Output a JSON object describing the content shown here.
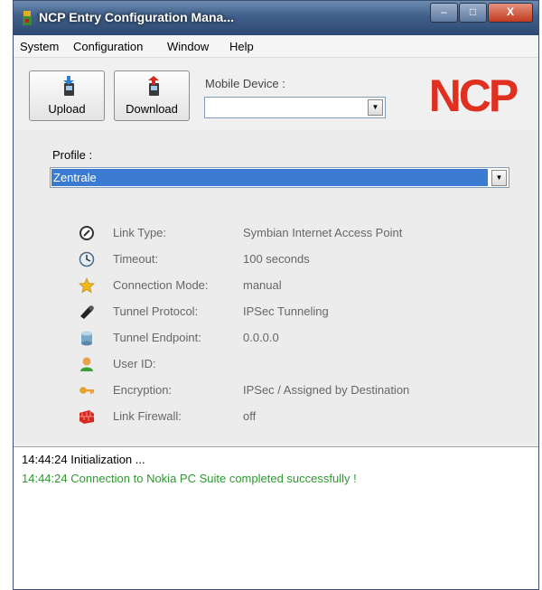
{
  "window": {
    "title": "NCP Entry Configuration Mana...",
    "buttons": {
      "minimize": "‒",
      "maximize": "□",
      "close": "X"
    }
  },
  "menu": [
    "System",
    "Configuration",
    "Window",
    "Help"
  ],
  "toolbar": {
    "upload_label": "Upload",
    "download_label": "Download",
    "mobile_device_label": "Mobile Device :",
    "mobile_device_value": ""
  },
  "logo": {
    "text": "NCP",
    "color": "#e03020"
  },
  "profile": {
    "label": "Profile :",
    "value": "Zentrale"
  },
  "info": [
    {
      "icon": "link-type-icon",
      "label": "Link Type:",
      "value": "Symbian Internet Access Point"
    },
    {
      "icon": "timeout-clock-icon",
      "label": "Timeout:",
      "value": "100 seconds"
    },
    {
      "icon": "star-icon",
      "label": "Connection Mode:",
      "value": "manual"
    },
    {
      "icon": "tunnel-pipe-icon",
      "label": "Tunnel Protocol:",
      "value": "IPSec Tunneling"
    },
    {
      "icon": "endpoint-cylinder-icon",
      "label": "Tunnel Endpoint:",
      "value": "0.0.0.0"
    },
    {
      "icon": "user-icon",
      "label": "User ID:",
      "value": ""
    },
    {
      "icon": "key-icon",
      "label": "Encryption:",
      "value": "IPSec / Assigned by Destination"
    },
    {
      "icon": "firewall-brick-icon",
      "label": "Link Firewall:",
      "value": "off"
    }
  ],
  "log": [
    {
      "time": "14:44:24",
      "text": "Initialization ...",
      "color": "#000000"
    },
    {
      "time": "14:44:24",
      "text": "Connection to Nokia PC Suite completed successfully !",
      "color": "#2e9a2e"
    }
  ]
}
